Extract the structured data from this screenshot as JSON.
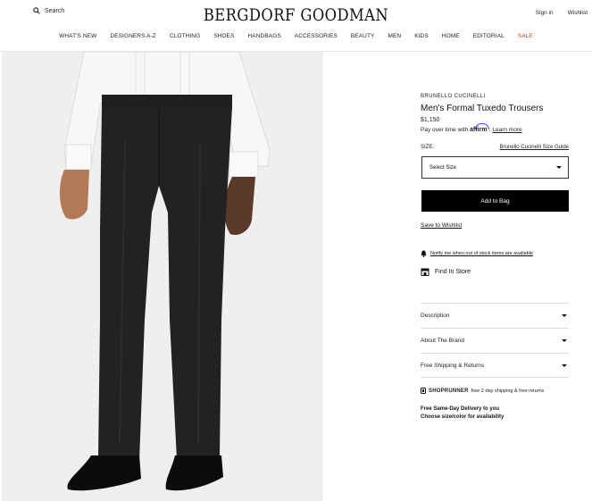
{
  "header": {
    "search_label": "Search",
    "logo": "BERGDORF GOODMAN",
    "sign_in": "Sign in",
    "wishlist": "Wishlist"
  },
  "nav": {
    "items": [
      "WHAT'S NEW",
      "DESIGNERS A-Z",
      "CLOTHING",
      "SHOES",
      "HANDBAGS",
      "ACCESSORIES",
      "BEAUTY",
      "MEN",
      "KIDS",
      "HOME",
      "EDITORIAL",
      "SALE"
    ],
    "sale_color": "#c0392b"
  },
  "product": {
    "brand": "BRUNELLO CUCINELLI",
    "title": "Men's Formal Tuxedo Trousers",
    "price": "$1,150",
    "affirm_prefix": "Pay over time with",
    "affirm_logo": "affirm",
    "affirm_link": "Learn more",
    "size_label": "SIZE:",
    "size_guide": "Brunello Cucinelli Size Guide",
    "select_placeholder": "Select Size",
    "add_to_bag": "Add to Bag",
    "save_to_wishlist": "Save to Wishlist",
    "notify": "Notify me when out of stock items are available",
    "find_in_store": "Find In Store",
    "accordions": [
      "Description",
      "About The Brand",
      "Free Shipping & Returns"
    ],
    "shoprunner_brand": "SHOPRUNNER",
    "shoprunner_text": "free 2-day shipping & free returns",
    "same_day_line1": "Free Same-Day Delivery to you",
    "same_day_line2": "Choose size/color for availability"
  },
  "colors": {
    "button_bg": "#000000",
    "image_bg": "#f0f0f0",
    "affirm_blue": "#4a4af4"
  },
  "icons": [
    "search-icon",
    "bell-icon",
    "store-icon",
    "chevron-down-icon",
    "shoprunner-icon"
  ]
}
